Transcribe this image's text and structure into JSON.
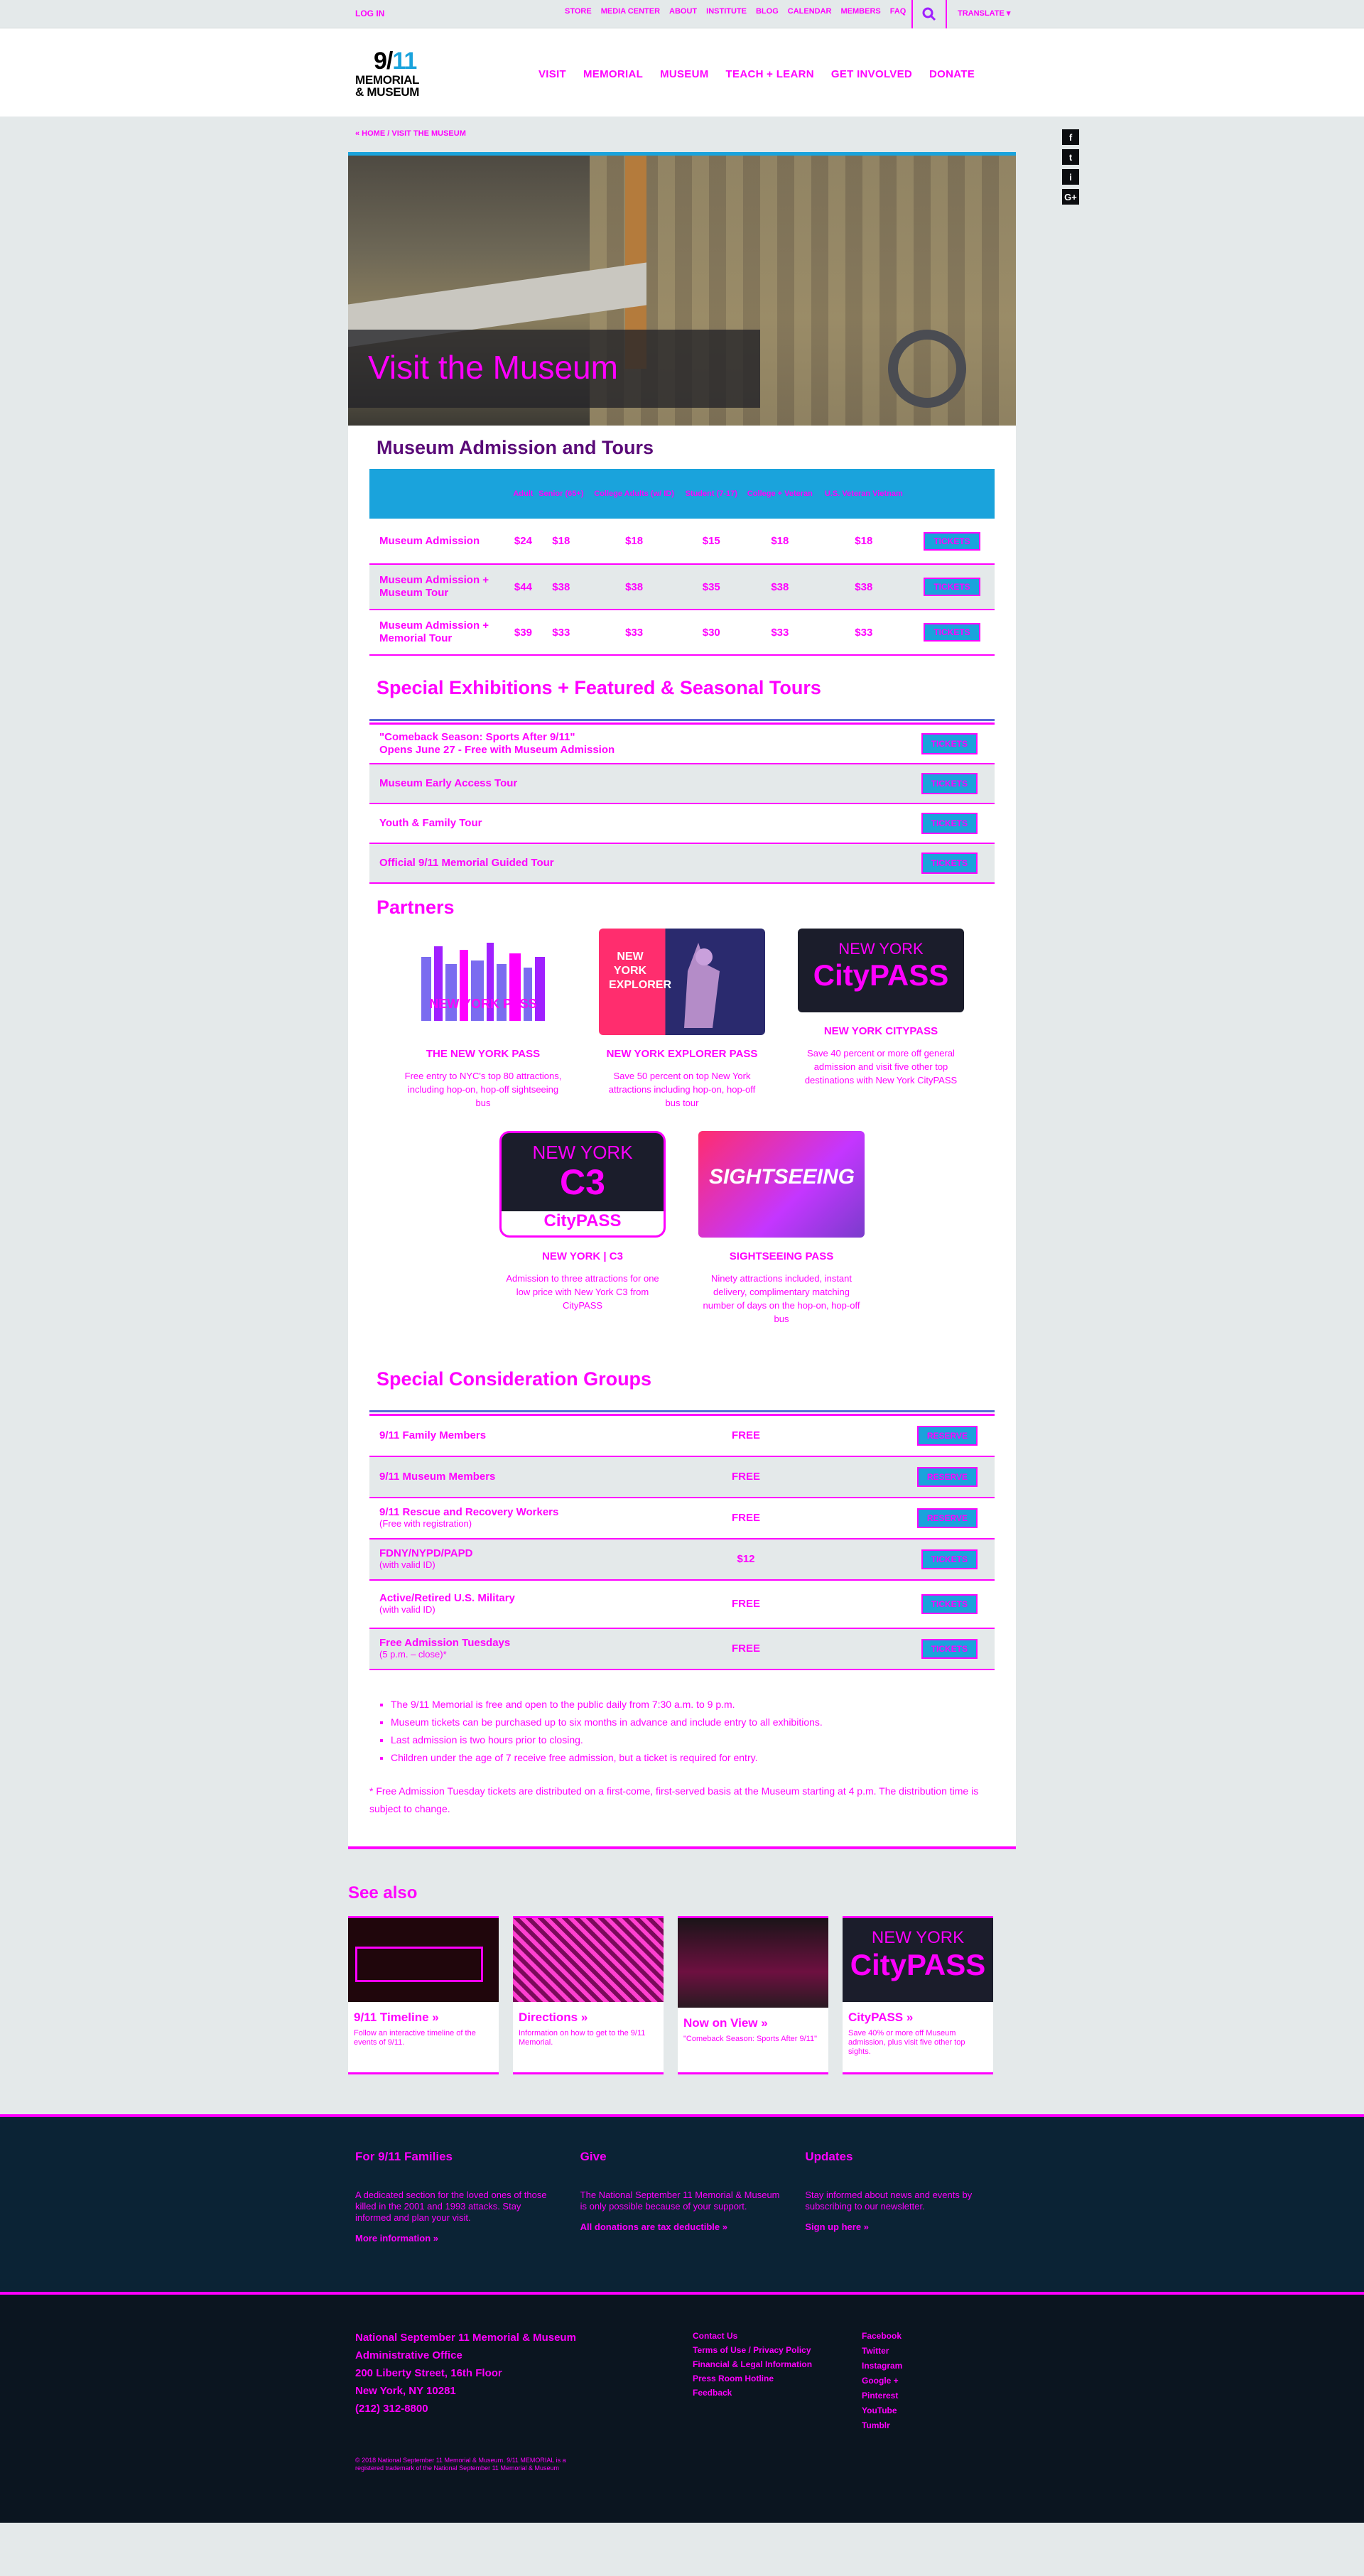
{
  "util": {
    "login": "LOG IN",
    "links": [
      "STORE",
      "MEDIA CENTER",
      "ABOUT",
      "INSTITUTE",
      "BLOG",
      "CALENDAR",
      "MEMBERS",
      "FAQ"
    ],
    "translate": "TRANSLATE"
  },
  "logo": {
    "num_a": "9/",
    "num_b": "11",
    "line1": "MEMORIAL",
    "line2": "& MUSEUM"
  },
  "nav": [
    "VISIT",
    "MEMORIAL",
    "MUSEUM",
    "TEACH + LEARN",
    "GET INVOLVED",
    "DONATE"
  ],
  "breadcrumb": {
    "home": "« HOME",
    "sep": "/",
    "current": "VISIT THE MUSEUM"
  },
  "social_side": [
    "f",
    "t",
    "i",
    "G+"
  ],
  "hero": {
    "title": "Visit the Museum"
  },
  "admission": {
    "heading": "Museum Admission and Tours",
    "columns": [
      "Adult",
      "Senior (65+)",
      "College Adults (w/ ID)",
      "Student (7-17)",
      "College + Veteran",
      "U.S. Veteran Vietnam"
    ],
    "rows": [
      {
        "label": "Museum Admission",
        "values": [
          "$24",
          "$18",
          "$18",
          "$15",
          "$18",
          "$18"
        ],
        "btn": "TICKETS"
      },
      {
        "label": "Museum Admission + Museum Tour",
        "values": [
          "$44",
          "$38",
          "$38",
          "$35",
          "$38",
          "$38"
        ],
        "btn": "TICKETS"
      },
      {
        "label": "Museum Admission + Memorial Tour",
        "values": [
          "$39",
          "$33",
          "$33",
          "$30",
          "$33",
          "$33"
        ],
        "btn": "TICKETS"
      }
    ]
  },
  "exhibitions": {
    "heading": "Special Exhibitions + Featured & Seasonal Tours",
    "rows": [
      {
        "line1": "\"Comeback Season: Sports After 9/11\"",
        "line2": "Opens June 27 - Free with Museum Admission",
        "btn": "TICKETS"
      },
      {
        "line1": "Museum Early Access Tour",
        "line2": "",
        "btn": "TICKETS"
      },
      {
        "line1": "Youth & Family Tour",
        "line2": "",
        "btn": "TICKETS"
      },
      {
        "line1": "Official 9/11 Memorial Guided Tour",
        "line2": "",
        "btn": "TICKETS"
      }
    ]
  },
  "partners": {
    "heading": "Partners",
    "items": [
      {
        "name": "THE NEW YORK PASS",
        "desc": "Free entry to NYC's top 80 attractions, including hop-on, hop-off sightseeing bus",
        "img_text": "NEW YORK PASS"
      },
      {
        "name": "NEW YORK EXPLORER PASS",
        "desc": "Save 50 percent on top New York attractions including hop-on, hop-off bus tour",
        "img_text": "NEW YORK EXPLORER"
      },
      {
        "name": "NEW YORK CITYPASS",
        "desc": "Save 40 percent or more off general admission and visit five other top destinations with New York CityPASS",
        "img_text_a": "NEW YORK",
        "img_text_b": "CityPASS"
      },
      {
        "name": "NEW YORK | C3",
        "desc": "Admission to three attractions for one low price with New York C3 from CityPASS",
        "img_text_a": "NEW YORK",
        "img_text_b": "C3",
        "img_text_c": "CityPASS"
      },
      {
        "name": "SIGHTSEEING PASS",
        "desc": "Ninety attractions included, instant delivery, complimentary matching number of days on the hop-on, hop-off bus",
        "img_text": "SIGHTSEEING"
      }
    ]
  },
  "special": {
    "heading": "Special Consideration Groups",
    "rows": [
      {
        "label": "9/11 Family Members",
        "sub": "",
        "price": "FREE",
        "btn": "RESERVE"
      },
      {
        "label": "9/11 Museum Members",
        "sub": "",
        "price": "FREE",
        "btn": "RESERVE"
      },
      {
        "label": "9/11 Rescue and Recovery Workers",
        "sub": "(Free with registration)",
        "price": "FREE",
        "btn": "RESERVE"
      },
      {
        "label": "FDNY/NYPD/PAPD",
        "sub": "(with valid ID)",
        "price": "$12",
        "btn": "TICKETS"
      },
      {
        "label": "Active/Retired U.S. Military",
        "sub": "(with valid ID)",
        "price": "FREE",
        "btn": "TICKETS"
      },
      {
        "label": "Free Admission Tuesdays",
        "sub": "(5 p.m. – close)*",
        "price": "FREE",
        "btn": "TICKETS"
      }
    ]
  },
  "notes": [
    "The 9/11 Memorial is free and open to the public daily from 7:30 a.m. to 9 p.m.",
    "Museum tickets can be purchased up to six months in advance and include entry to all exhibitions.",
    "Last admission is two hours prior to closing.",
    "Children under the age of 7 receive free admission, but a ticket is required for entry."
  ],
  "footnote": "* Free Admission Tuesday tickets are distributed on a first-come, first-served basis at the Museum starting at 4 p.m. The distribution time is subject to change.",
  "see_also": {
    "heading": "See also",
    "cards": [
      {
        "title": "9/11 Timeline »",
        "desc": "Follow an interactive timeline of the events of 9/11."
      },
      {
        "title": "Directions »",
        "desc": "Information on how to get to the 9/11 Memorial."
      },
      {
        "title": "Now on View »",
        "desc": "\"Comeback Season: Sports After 9/11\""
      },
      {
        "title": "CityPASS »",
        "desc": "Save 40% or more off Museum admission, plus visit five other top sights.",
        "img_a": "NEW YORK",
        "img_b": "CityPASS"
      }
    ]
  },
  "footer": {
    "cols": [
      {
        "title": "For 9/11 Families",
        "text": "A dedicated section for the loved ones of those killed in the 2001 and 1993 attacks. Stay informed and plan your visit.",
        "link": "More information »"
      },
      {
        "title": "Give",
        "text": "The National September 11 Memorial & Museum is only possible because of your support.",
        "link": "All donations are tax deductible »"
      },
      {
        "title": "Updates",
        "text": "Stay informed about news and events by subscribing to our newsletter.",
        "link": "Sign up here »"
      }
    ],
    "address": [
      "National September 11 Memorial & Museum",
      "Administrative Office",
      "200 Liberty Street, 16th Floor",
      "New York, NY 10281",
      "(212) 312-8800"
    ],
    "copyright": "© 2018 National September 11 Memorial & Museum. 9/11 MEMORIAL is a registered trademark of the National September 11 Memorial & Museum",
    "links": [
      "Contact Us",
      "Terms of Use / Privacy Policy",
      "Financial & Legal Information",
      "Press Room Hotline",
      "Feedback"
    ],
    "social": [
      "Facebook",
      "Twitter",
      "Instagram",
      "Google +",
      "Pinterest",
      "YouTube",
      "Tumblr"
    ]
  }
}
